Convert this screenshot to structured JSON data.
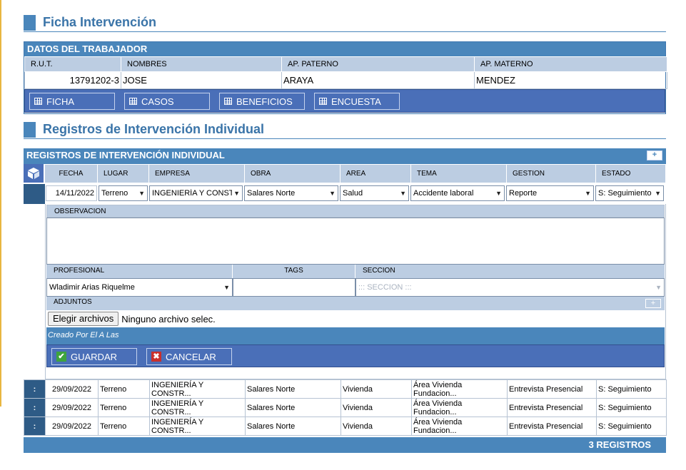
{
  "page": {
    "section1_title": "Ficha Intervención",
    "section2_title": "Registros de Intervención Individual"
  },
  "worker": {
    "panel_title": "DATOS DEL TRABAJADOR",
    "headers": [
      "R.U.T.",
      "NOMBRES",
      "AP. PATERNO",
      "AP. MATERNO"
    ],
    "rut": "13791202-3",
    "nombres": "JOSE",
    "paterno": "ARAYA",
    "materno": "MENDEZ",
    "tabs": [
      "FICHA",
      "CASOS",
      "BENEFICIOS",
      "ENCUESTA"
    ]
  },
  "registros": {
    "panel_title": "REGISTROS DE INTERVENCIÓN INDIVIDUAL",
    "add_label": "+",
    "columns": [
      "FECHA",
      "LUGAR",
      "EMPRESA",
      "OBRA",
      "AREA",
      "TEMA",
      "GESTION",
      "ESTADO"
    ],
    "form": {
      "fecha": "14/11/2022",
      "lugar": "Terreno",
      "empresa": "INGENIERÍA Y CONSTRUC",
      "obra": "Salares Norte",
      "area": "Salud",
      "tema": "Accidente laboral",
      "gestion": "Reporte",
      "estado": "S: Seguimiento",
      "observacion_label": "OBSERVACION",
      "observacion_value": "",
      "profesional_label": "PROFESIONAL",
      "tags_label": "TAGS",
      "seccion_label": "SECCION",
      "profesional_value": "Wladimir Arias Riquelme",
      "tags_value": "",
      "seccion_placeholder": "::: SECCION :::",
      "adjuntos_label": "ADJUNTOS",
      "adjuntos_add": "+",
      "file_button": "Elegir archivos",
      "file_status": "Ninguno archivo selec.",
      "created_by": "Creado Por El A Las",
      "save_label": "GUARDAR",
      "cancel_label": "CANCELAR"
    },
    "rows": [
      {
        "menu": ":",
        "fecha": "29/09/2022",
        "lugar": "Terreno",
        "empresa": "INGENIERÍA Y CONSTR...",
        "obra": "Salares Norte",
        "area": "Vivienda",
        "tema": "Área Vivienda Fundacion...",
        "gestion": "Entrevista Presencial",
        "estado": "S: Seguimiento"
      },
      {
        "menu": ":",
        "fecha": "29/09/2022",
        "lugar": "Terreno",
        "empresa": "INGENIERÍA Y CONSTR...",
        "obra": "Salares Norte",
        "area": "Vivienda",
        "tema": "Área Vivienda Fundacion...",
        "gestion": "Entrevista Presencial",
        "estado": "S: Seguimiento"
      },
      {
        "menu": ":",
        "fecha": "29/09/2022",
        "lugar": "Terreno",
        "empresa": "INGENIERÍA Y CONSTR...",
        "obra": "Salares Norte",
        "area": "Vivienda",
        "tema": "Área Vivienda Fundacion...",
        "gestion": "Entrevista Presencial",
        "estado": "S: Seguimiento"
      }
    ],
    "footer_count": "3 REGISTROS"
  }
}
